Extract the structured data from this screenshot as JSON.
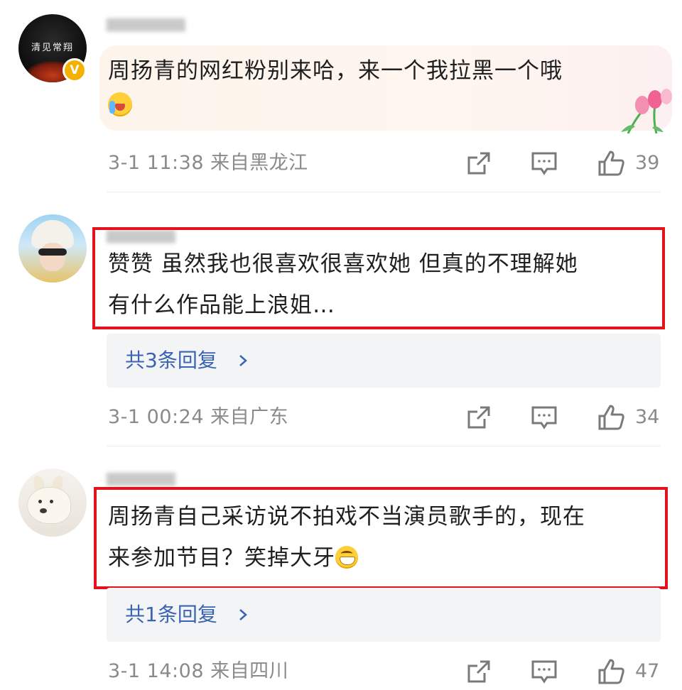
{
  "comments": [
    {
      "text_line1": "周扬青的网红粉别来哈，来一个我拉黑一个哦",
      "emoji": "crying-laughing-emoji",
      "meta": "3-1 11:38  来自黑龙江",
      "likes": "39",
      "verified_badge": "V",
      "avatar_text": "清见常翔",
      "highlighted": false
    },
    {
      "text_line1": "赞赞 虽然我也很喜欢很喜欢她 但真的不理解她",
      "text_line2": "有什么作品能上浪姐…",
      "replies": "共3条回复",
      "meta": "3-1 00:24  来自广东",
      "likes": "34",
      "highlighted": true
    },
    {
      "text_line1": "周扬青自己采访说不拍戏不当演员歌手的，现在",
      "text_line2": "来参加节目？笑掉大牙",
      "emoji": "grinning-emoji",
      "replies": "共1条回复",
      "meta": "3-1 14:08  来自四川",
      "likes": "47",
      "highlighted": true
    }
  ],
  "icons": {
    "share": "share-icon",
    "comment": "comment-icon",
    "like": "thumbs-up-icon",
    "chevron": "chevron-right-icon"
  },
  "colors": {
    "highlight_border": "#e3121b",
    "reply_link": "#3a63b3",
    "meta_text": "#8a8a8a",
    "reply_bg": "#f3f4f6",
    "verified": "#f5b100"
  }
}
